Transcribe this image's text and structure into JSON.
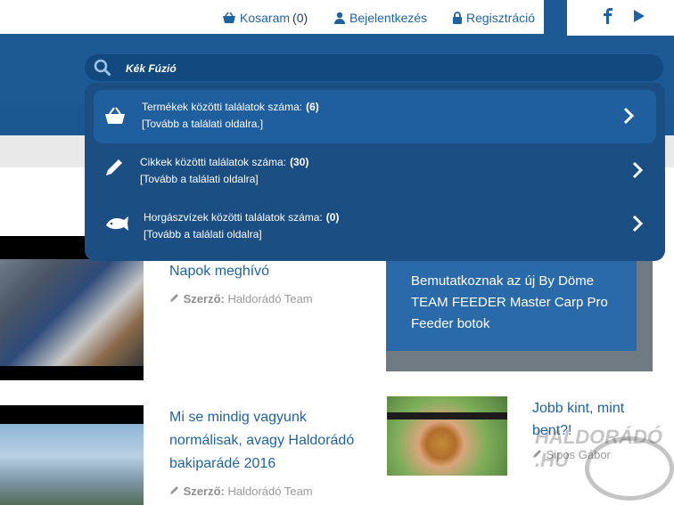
{
  "topnav": {
    "cart_label": "Kosaram",
    "cart_count": "(0)",
    "login_label": "Bejelentkezés",
    "register_label": "Regisztráció"
  },
  "social": {
    "icons": [
      "facebook-icon",
      "youtube-play-icon"
    ]
  },
  "search": {
    "value": "Kék Fúzió"
  },
  "dropdown": {
    "items": [
      {
        "label": "Termékek közötti találatok száma:",
        "count": "(6)",
        "link": "[Tovább a találati oldalra.]",
        "icon": "basket-icon"
      },
      {
        "label": "Cikkek közötti találatok száma:",
        "count": "(30)",
        "link": "[Tovább a találati oldalra]",
        "icon": "pencil-icon"
      },
      {
        "label": "Horgászvízek közötti találatok száma:",
        "count": "(0)",
        "link": "[Tovább a találati oldalra]",
        "icon": "fish-icon"
      }
    ]
  },
  "articles": [
    {
      "title": "Napok meghívó",
      "author_label": "Szerző:",
      "author": "Haldorádó Team"
    },
    {
      "title": "Mi se mindig vagyunk normálisak, avagy Haldorádó bakiparádé 2016",
      "author_label": "Szerző:",
      "author": "Haldorádó Team"
    }
  ],
  "featured": {
    "title": "Bemutatkoznak az új By Döme TEAM FEEDER Master Carp Pro Feeder botok"
  },
  "side_article": {
    "title": "Jobb kint, mint bent?!",
    "author": "Sipos Gábor"
  },
  "watermark": {
    "line1": "HALDORÁDÓ",
    "line2": ".HU"
  },
  "colors": {
    "header": "#1d5a93",
    "dropdown": "#1b4f84",
    "accent": "#1e63a0"
  }
}
